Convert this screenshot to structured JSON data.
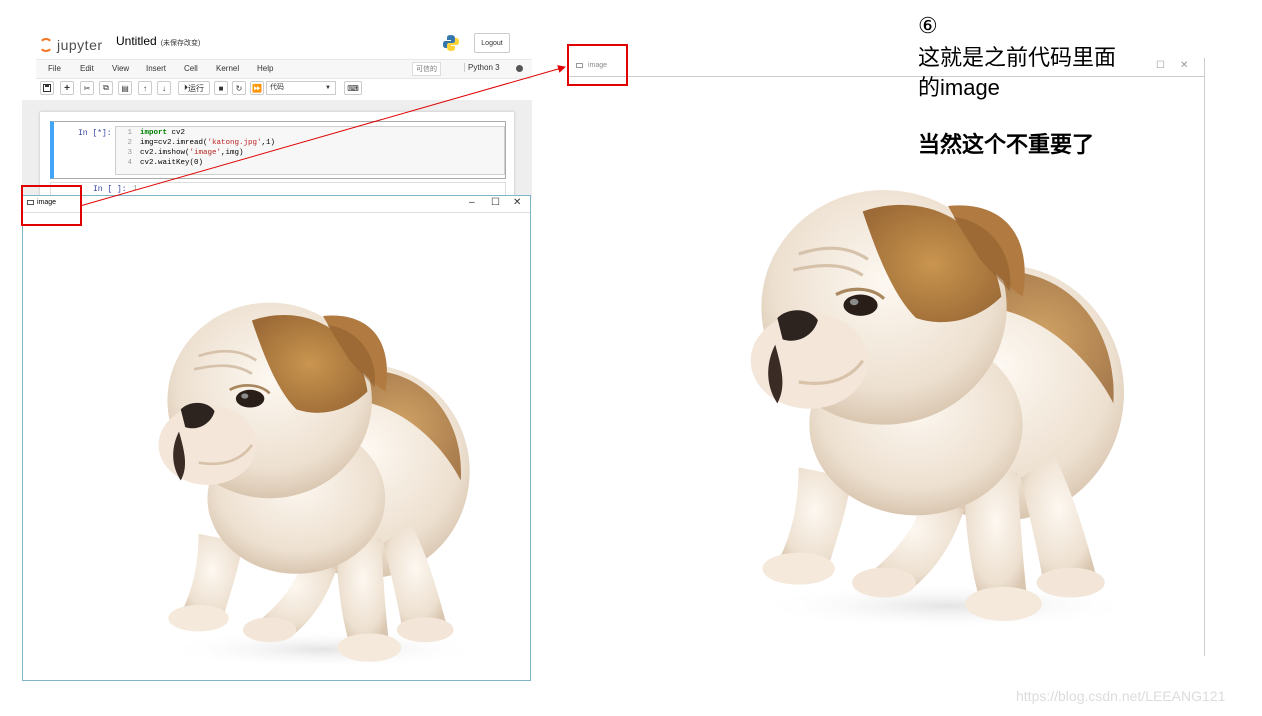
{
  "jupyter": {
    "logo_text": "jupyter",
    "notebook_title": "Untitled",
    "unsaved_note": "(未保存改变)",
    "logout_label": "Logout",
    "menu": [
      "File",
      "Edit",
      "View",
      "Insert",
      "Cell",
      "Kernel",
      "Help"
    ],
    "trusted_label": "可信的",
    "kernel_name": "Python 3",
    "toolbar": {
      "run_label": "运行",
      "cell_type": "代码"
    },
    "cell1": {
      "prompt": "In [*]:",
      "lines": [
        {
          "num": "1",
          "kw": "import",
          "rest": " cv2"
        },
        {
          "num": "2",
          "pre": "img=cv2.imread(",
          "str": "'katong.jpg'",
          "post": ",1)"
        },
        {
          "num": "3",
          "pre": "cv2.imshow(",
          "str": "'image'",
          "post": ",img)"
        },
        {
          "num": "4",
          "pre": "cv2.waitKey(0)"
        }
      ]
    },
    "cell2": {
      "prompt": "In [ ]:",
      "line_num": "1"
    }
  },
  "image_window_small": {
    "title": "image",
    "controls": [
      "–",
      "☐",
      "✕"
    ]
  },
  "image_window_large": {
    "title": "image",
    "controls": [
      "☐",
      "✕"
    ]
  },
  "annotation": {
    "step": "⑥",
    "line1": "这就是之前代码里面",
    "line2": "的image",
    "line3": "当然这个不重要了"
  },
  "watermark": "https://blog.csdn.net/LEEANG121",
  "colors": {
    "highlight_red": "#e00000",
    "arrow_red": "#e00000",
    "cell_active_blue": "#42a5f5",
    "jupyter_orange": "#f37726"
  },
  "icons": [
    "jupyter-logo-icon",
    "python-logo-icon",
    "save-icon",
    "plus-icon",
    "cut-icon",
    "copy-icon",
    "paste-icon",
    "arrow-up-icon",
    "arrow-down-icon",
    "run-icon",
    "stop-icon",
    "restart-icon",
    "fast-forward-icon",
    "keyboard-icon",
    "window-icon",
    "puppy-image"
  ]
}
